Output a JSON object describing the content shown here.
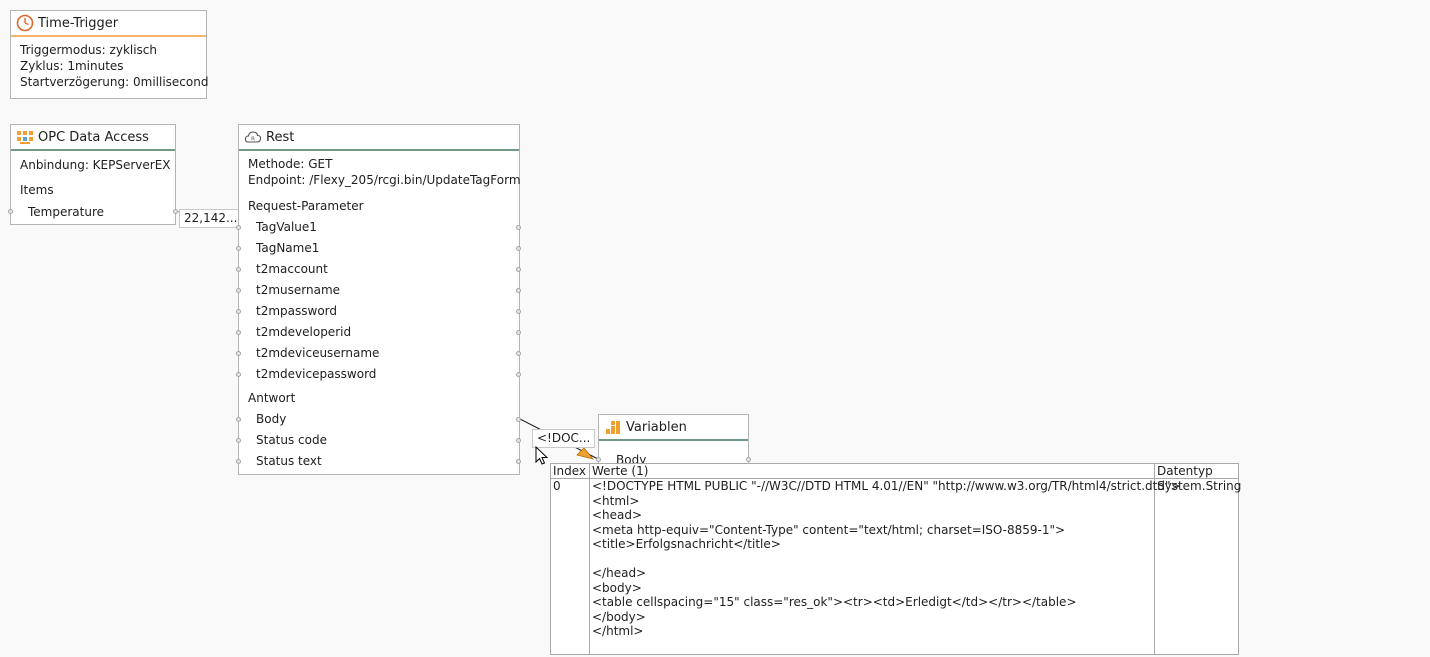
{
  "time_trigger": {
    "title": "Time-Trigger",
    "lines": [
      "Triggermodus: zyklisch",
      "Zyklus: 1minutes",
      "Startverzögerung: 0millisecond"
    ]
  },
  "opc": {
    "title": "OPC Data Access",
    "binding": "Anbindung: KEPServerEX",
    "items_header": "Items",
    "item": "Temperature",
    "value_preview": "22,142..."
  },
  "rest": {
    "title": "Rest",
    "method": "Methode: GET",
    "endpoint": "Endpoint: /Flexy_205/rcgi.bin/UpdateTagForm",
    "request_header": "Request-Parameter",
    "params": [
      "TagValue1",
      "TagName1",
      "t2maccount",
      "t2musername",
      "t2mpassword",
      "t2mdeveloperid",
      "t2mdeviceusername",
      "t2mdevicepassword"
    ],
    "response_header": "Antwort",
    "response": [
      "Body",
      "Status code",
      "Status text"
    ],
    "body_preview": "<!DOC..."
  },
  "variablen": {
    "title": "Variablen",
    "item": "Body"
  },
  "grid": {
    "headers": [
      "Index",
      "Werte (1)",
      "Datentyp"
    ],
    "row": {
      "index": "0",
      "value": "<!DOCTYPE HTML PUBLIC \"-//W3C//DTD HTML 4.01//EN\" \"http://www.w3.org/TR/html4/strict.dtd\">\n<html>\n<head>\n<meta http-equiv=\"Content-Type\" content=\"text/html; charset=ISO-8859-1\">\n<title>Erfolgsnachricht</title>\n\n</head>\n<body>\n<table cellspacing=\"15\" class=\"res_ok\"><tr><td>Erledigt</td></tr></table>\n</body>\n</html>",
      "type": "System.String"
    }
  },
  "colors": {
    "orange": "#f4b26b",
    "green": "#6f9a86",
    "icon_orange": "#f0a030"
  }
}
